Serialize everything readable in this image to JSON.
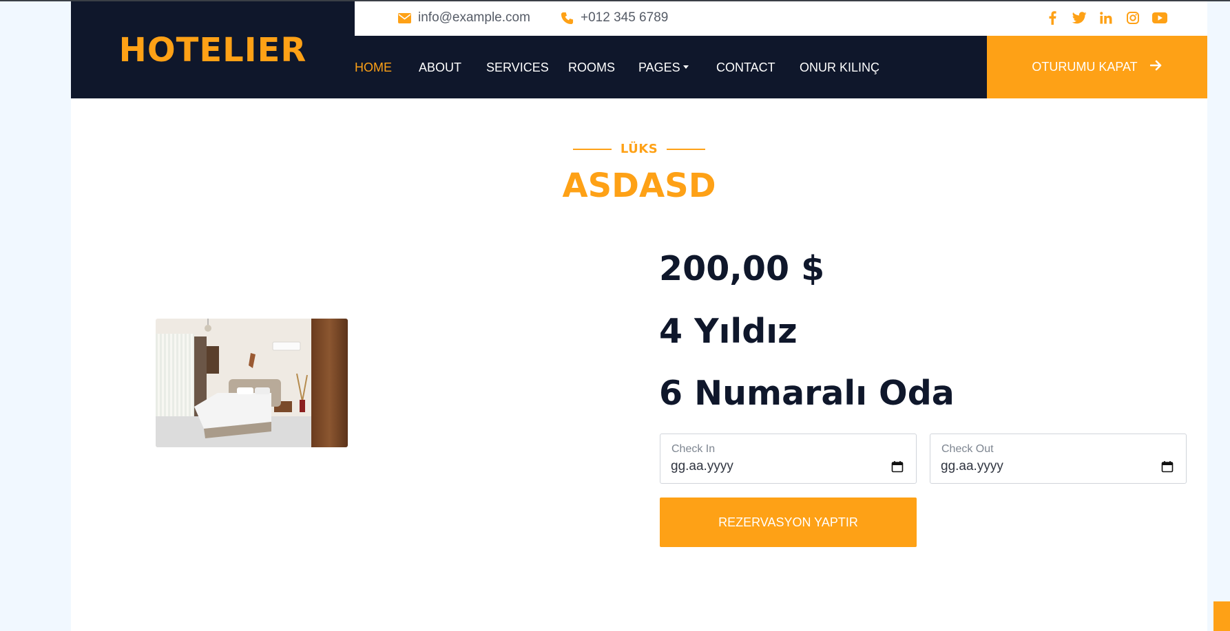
{
  "brand": {
    "name": "HOTELIER"
  },
  "topbar": {
    "email": "info@example.com",
    "phone": "+012 345 6789",
    "social": [
      "facebook-icon",
      "twitter-icon",
      "linkedin-icon",
      "instagram-icon",
      "youtube-icon"
    ]
  },
  "nav": {
    "items": [
      {
        "label": "HOME",
        "active": true
      },
      {
        "label": "ABOUT"
      },
      {
        "label": "SERVICES"
      },
      {
        "label": "ROOMS"
      },
      {
        "label": "PAGES"
      },
      {
        "label": "CONTACT"
      },
      {
        "label": "ONUR KILINÇ"
      }
    ],
    "logout_label": "OTURUMU KAPAT"
  },
  "room": {
    "category": "LÜKS",
    "name": "ASDASD",
    "price": "200,00 $",
    "stars": "4 Yıldız",
    "room_number": "6 Numaralı Oda"
  },
  "booking": {
    "check_in_label": "Check In",
    "check_in_value": "gg.aa.yyyy",
    "check_out_label": "Check Out",
    "check_out_value": "gg.aa.yyyy",
    "submit_label": "REZERVASYON YAPTIR"
  },
  "colors": {
    "accent": "#fea116",
    "dark": "#0f172b"
  }
}
